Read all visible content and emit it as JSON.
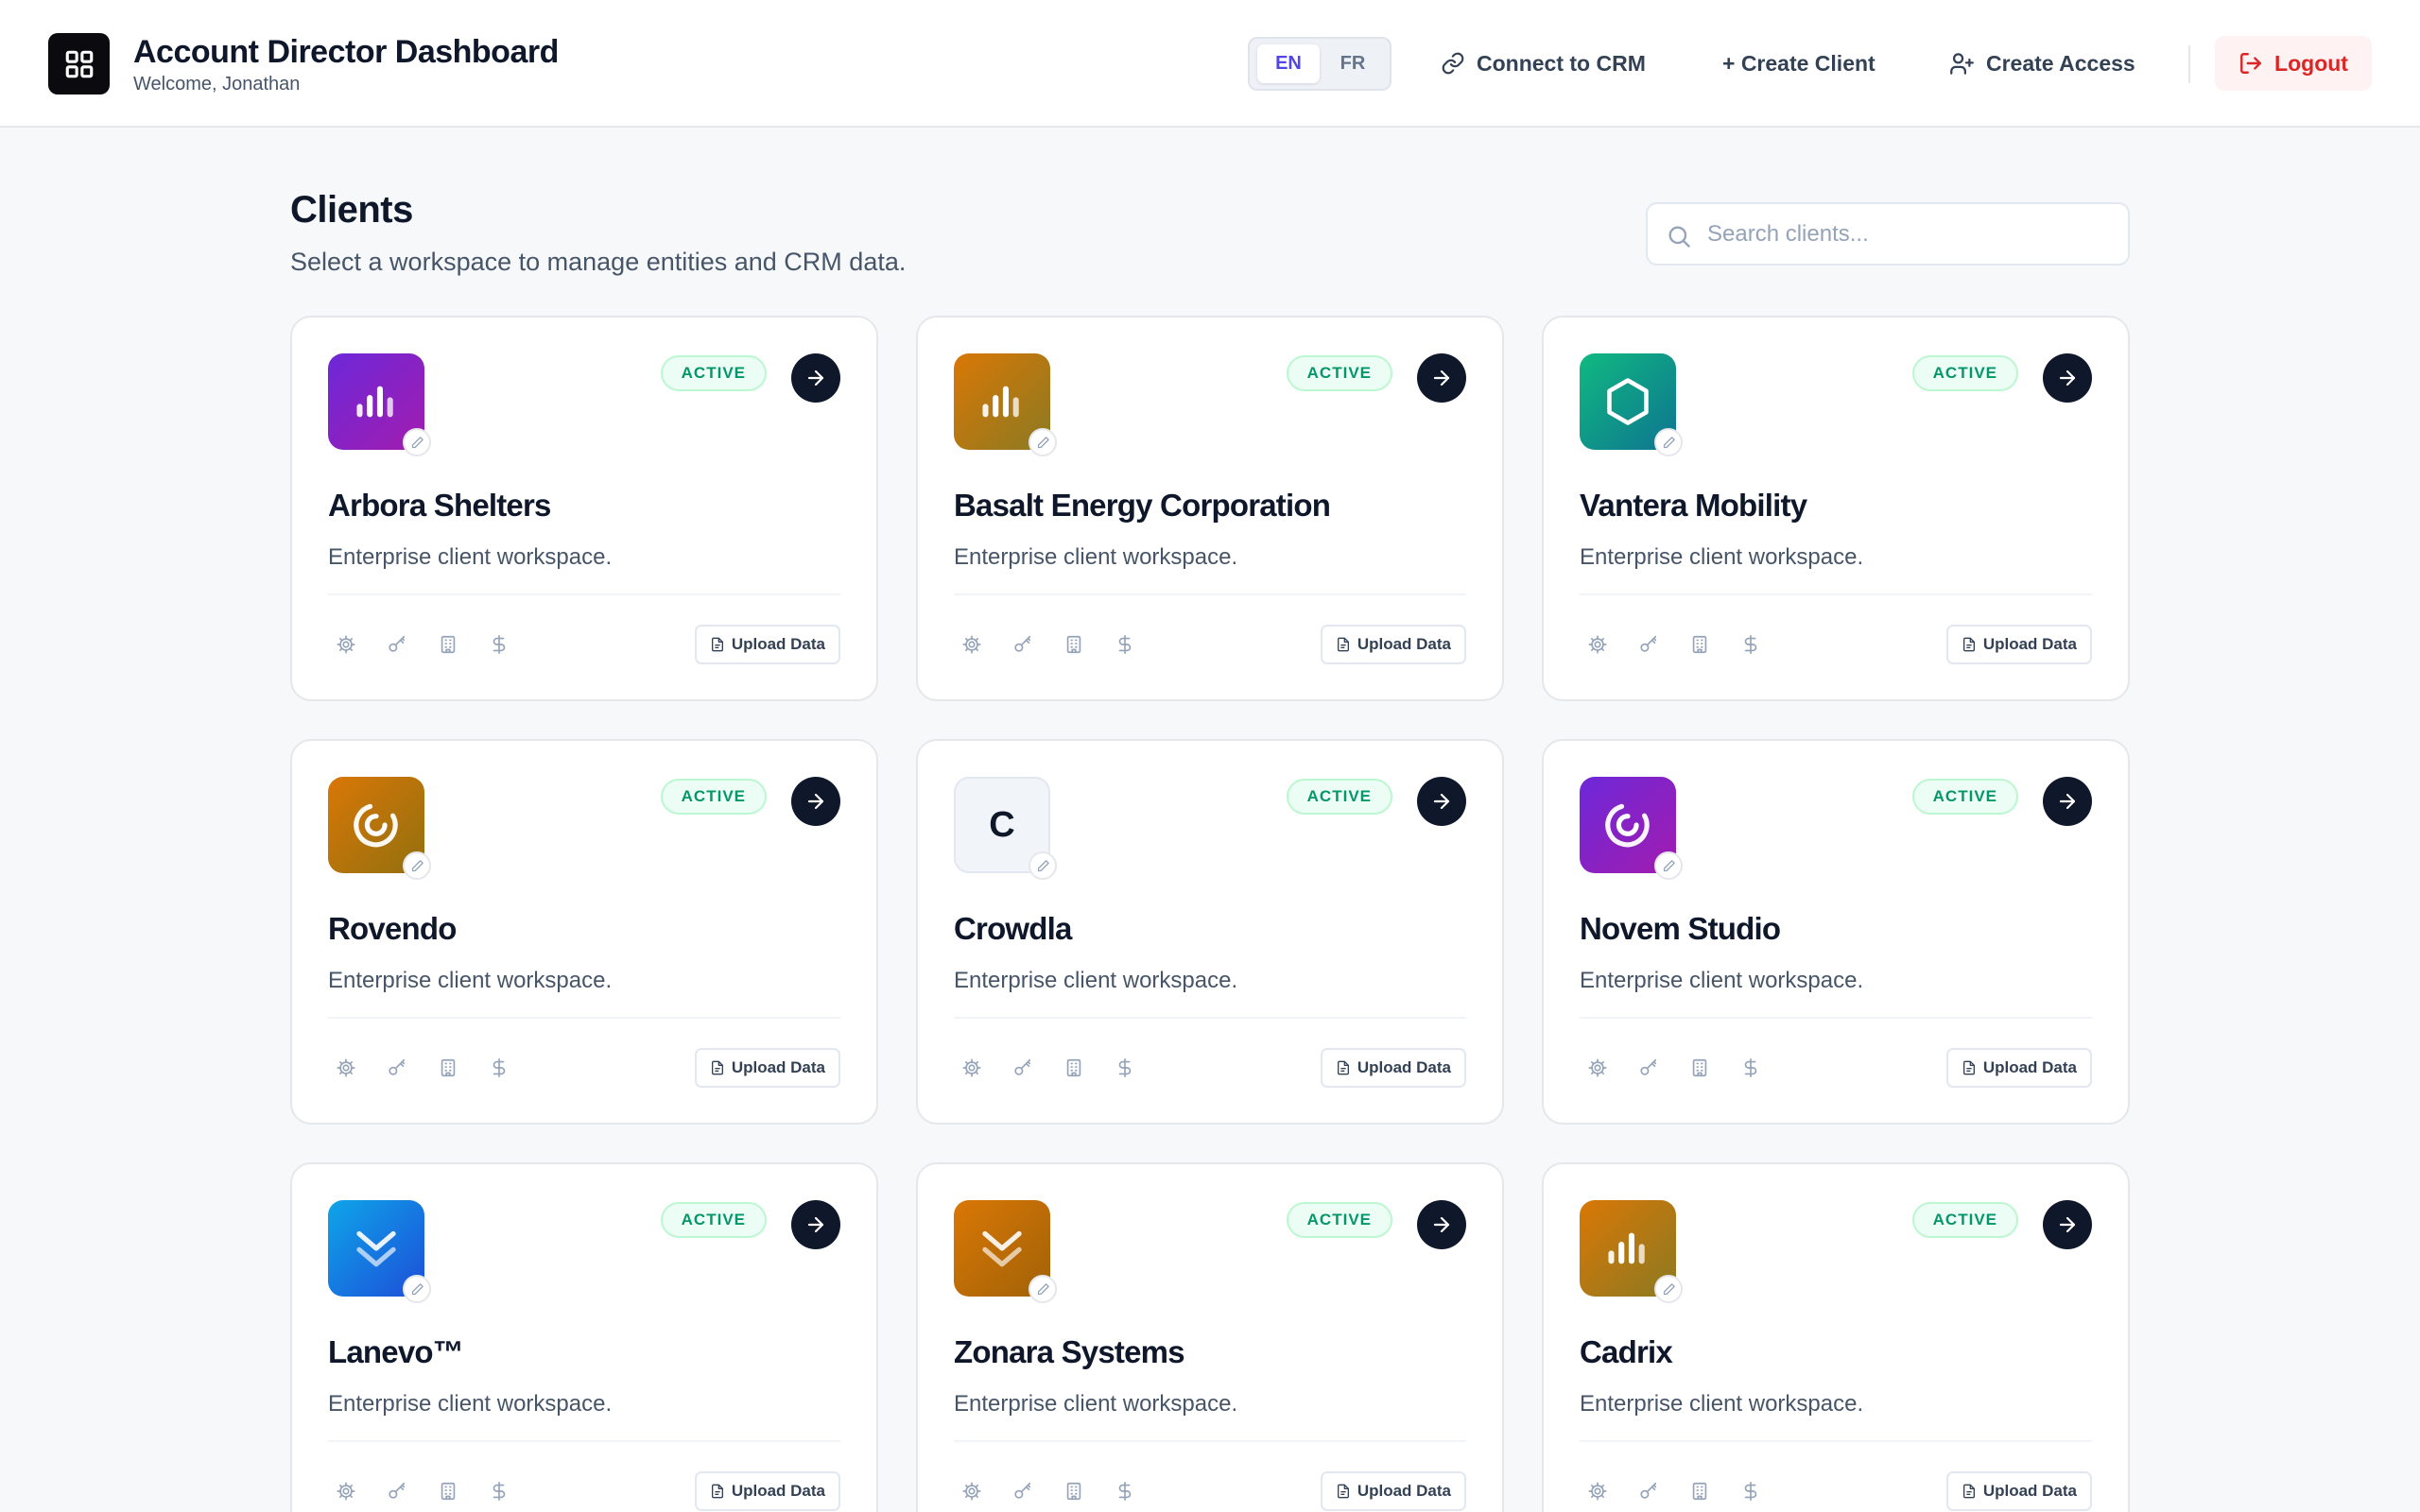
{
  "header": {
    "title": "Account Director Dashboard",
    "subtitle": "Welcome, Jonathan",
    "lang_options": [
      "EN",
      "FR"
    ],
    "lang_selected": "EN",
    "connect_crm_label": "Connect to CRM",
    "create_client_label": "+ Create Client",
    "create_access_label": "Create Access",
    "logout_label": "Logout",
    "logo_icon": "grid-icon"
  },
  "page": {
    "title": "Clients",
    "subtitle": "Select a workspace to manage entities and CRM data.",
    "search_placeholder": "Search clients..."
  },
  "colors": {
    "accent": "#4f46e5",
    "active_green": "#059669",
    "logout_red": "#dc2626",
    "dark": "#0f172a"
  },
  "clients": [
    {
      "name": "Arbora Shelters",
      "description": "Enterprise client workspace.",
      "status": "ACTIVE",
      "icon": "bars-icon",
      "gradient": [
        "#6d28d9",
        "#a21caf"
      ],
      "upload_label": "Upload Data"
    },
    {
      "name": "Basalt Energy Corporation",
      "description": "Enterprise client workspace.",
      "status": "ACTIVE",
      "icon": "bars-icon",
      "gradient": [
        "#d97706",
        "#8b7a22"
      ],
      "upload_label": "Upload Data"
    },
    {
      "name": "Vantera Mobility",
      "description": "Enterprise client workspace.",
      "status": "ACTIVE",
      "icon": "hexagon-icon",
      "gradient": [
        "#10b981",
        "#0e7490"
      ],
      "upload_label": "Upload Data"
    },
    {
      "name": "Rovendo",
      "description": "Enterprise client workspace.",
      "status": "ACTIVE",
      "icon": "spiral-icon",
      "gradient": [
        "#d97706",
        "#92700f"
      ],
      "upload_label": "Upload Data"
    },
    {
      "name": "Crowdla",
      "description": "Enterprise client workspace.",
      "status": "ACTIVE",
      "icon": "letter-c-icon",
      "letter": "C",
      "gradient": [],
      "upload_label": "Upload Data"
    },
    {
      "name": "Novem Studio",
      "description": "Enterprise client workspace.",
      "status": "ACTIVE",
      "icon": "spiral-icon",
      "gradient": [
        "#6d28d9",
        "#a21caf"
      ],
      "upload_label": "Upload Data"
    },
    {
      "name": "Lanevo™",
      "description": "Enterprise client workspace.",
      "status": "ACTIVE",
      "icon": "chevrons-down-icon",
      "gradient": [
        "#0ea5e9",
        "#1d4ed8"
      ],
      "upload_label": "Upload Data"
    },
    {
      "name": "Zonara Systems",
      "description": "Enterprise client workspace.",
      "status": "ACTIVE",
      "icon": "chevrons-down-icon",
      "gradient": [
        "#d97706",
        "#a16207"
      ],
      "upload_label": "Upload Data"
    },
    {
      "name": "Cadrix",
      "description": "Enterprise client workspace.",
      "status": "ACTIVE",
      "icon": "bars-icon",
      "gradient": [
        "#d97706",
        "#8b7a22"
      ],
      "upload_label": "Upload Data"
    }
  ]
}
